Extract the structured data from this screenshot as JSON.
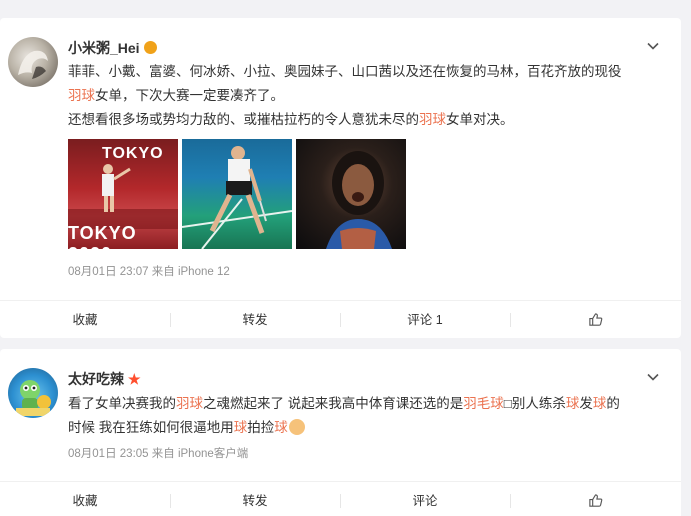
{
  "posts": [
    {
      "username": "小米粥_Hei",
      "badge": "crown",
      "line1_a": "菲菲、小戴、富婆、何冰娇、小拉、奥园妹子、山口茜以及还在恢复的马林，百花齐放的现役",
      "line2_hl": "羽球",
      "line2_b": "女单，下次大赛一定要凑齐了。",
      "line3_a": "还想看很多场或势均力敌的、或摧枯拉朽的令人意犹未尽的",
      "line3_hl": "羽球",
      "line3_b": "女单对决。",
      "photo1_text": "TOKYO",
      "photo1_text2": "TOKYO 2020",
      "meta": "08月01日 23:07  来自 iPhone 12",
      "actions": {
        "collect": "收藏",
        "repost": "转发",
        "comment": "评论 1"
      }
    },
    {
      "username": "太好吃辣",
      "badge": "star",
      "line1_a": "看了女单决赛我的",
      "line1_hl": "羽球",
      "line1_b": "之魂燃起来了 说起来我高中体育课还选的是",
      "line1_hl2": "羽毛球",
      "line1_c": "□别人练杀",
      "line1_hl3": "球",
      "line1_d": "发",
      "line1_hl4": "球",
      "line1_e": "的",
      "line2_a": "时候 我在狂练如何很逼地用",
      "line2_hl": "球",
      "line2_b": "拍捡",
      "line2_hl2": "球",
      "meta": "08月01日 23:05  来自 iPhone客户端",
      "actions": {
        "collect": "收藏",
        "repost": "转发",
        "comment": "评论"
      }
    }
  ],
  "colors": {
    "highlight": "#eb7350",
    "meta": "#939393",
    "background": "#f2f2f5"
  }
}
